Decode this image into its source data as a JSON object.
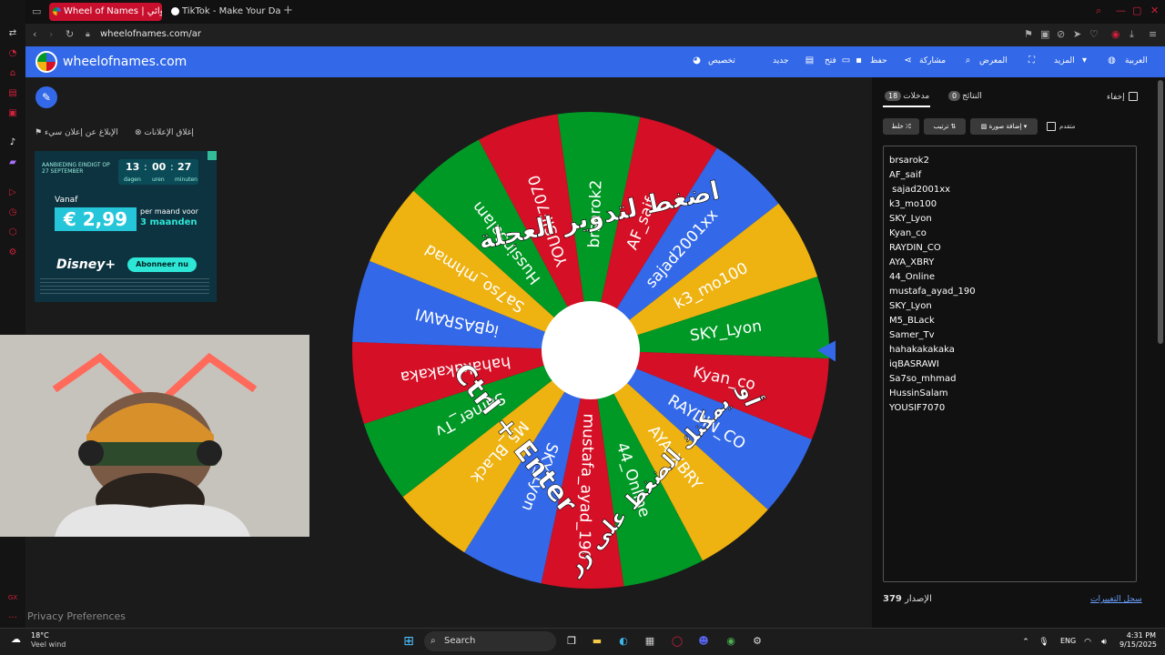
{
  "browser": {
    "tabs": [
      {
        "label": "Wheel of Names | عشوائي",
        "active": true
      },
      {
        "label": "TikTok - Make Your Day",
        "active": false
      }
    ],
    "url": "wheelofnames.com/ar",
    "url_path": "/ar"
  },
  "header": {
    "site_title": "wheelofnames.com",
    "nav": {
      "customize": "تخصيص",
      "new": "جديد",
      "open": "فتح",
      "save": "حفظ",
      "share": "مشاركة",
      "gallery": "المعرض",
      "more": "المزيد",
      "language": "العربية"
    }
  },
  "ads": {
    "close_ads": "إغلاق الإعلانات",
    "report_ad": "الإبلاغ عن إعلان سيء",
    "banner": {
      "headline": "AANBIEDING EINDIGT OP 27 SEPTEMBER",
      "countdown_days": "13",
      "countdown_hours": "00",
      "countdown_minutes": "27",
      "unit_days": "dagen",
      "unit_hours": "uren",
      "unit_minutes": "minuten",
      "vanaf": "Vanaf",
      "price": "€ 2,99",
      "price_note_1": "per maand voor",
      "price_note_2": "3 maanden",
      "brand": "Disney+",
      "cta": "Abonneer nu"
    }
  },
  "wheel": {
    "colors": [
      "#009925",
      "#d50f25",
      "#3369e8",
      "#eeb211"
    ],
    "pointer_color": "#3369e8",
    "overlay_top": "اضغط لتدوير العجلة",
    "overlay_or": "أو",
    "overlay_bottom": "يمكنك الضغط على زر",
    "overlay_shortcut": "Ctrl + Enter"
  },
  "panel": {
    "hide_label": "إخفاء",
    "results_label": "النتائج",
    "results_count": "0",
    "entries_label": "مدخلات",
    "entries_count": "18",
    "shuffle": "خلط",
    "sort": "ترتيب",
    "add_image": "إضافة صورة",
    "advanced": "متقدم",
    "entries": [
      "brsarok2",
      "AF_saif",
      " sajad2001xx",
      "k3_mo100",
      "SKY_Lyon",
      "Kyan_co",
      "RAYDIN_CO",
      "AYA_XBRY",
      "44_Online",
      "mustafa_ayad_190",
      "SKY_Lyon",
      "M5_BLack",
      "Samer_Tv",
      "hahakakakaka",
      "iqBASRAWI",
      "Sa7so_mhmad",
      "HussinSalam",
      "YOUSIF7070"
    ],
    "version_label": "الإصدار",
    "version_number": "379",
    "changelog": "سجل التغييرات"
  },
  "privacy": "Privacy Preferences",
  "taskbar": {
    "temperature": "18°C",
    "weather": "Veel wind",
    "search": "Search",
    "language": "ENG",
    "time": "4:31 PM",
    "date": "9/15/2025"
  }
}
